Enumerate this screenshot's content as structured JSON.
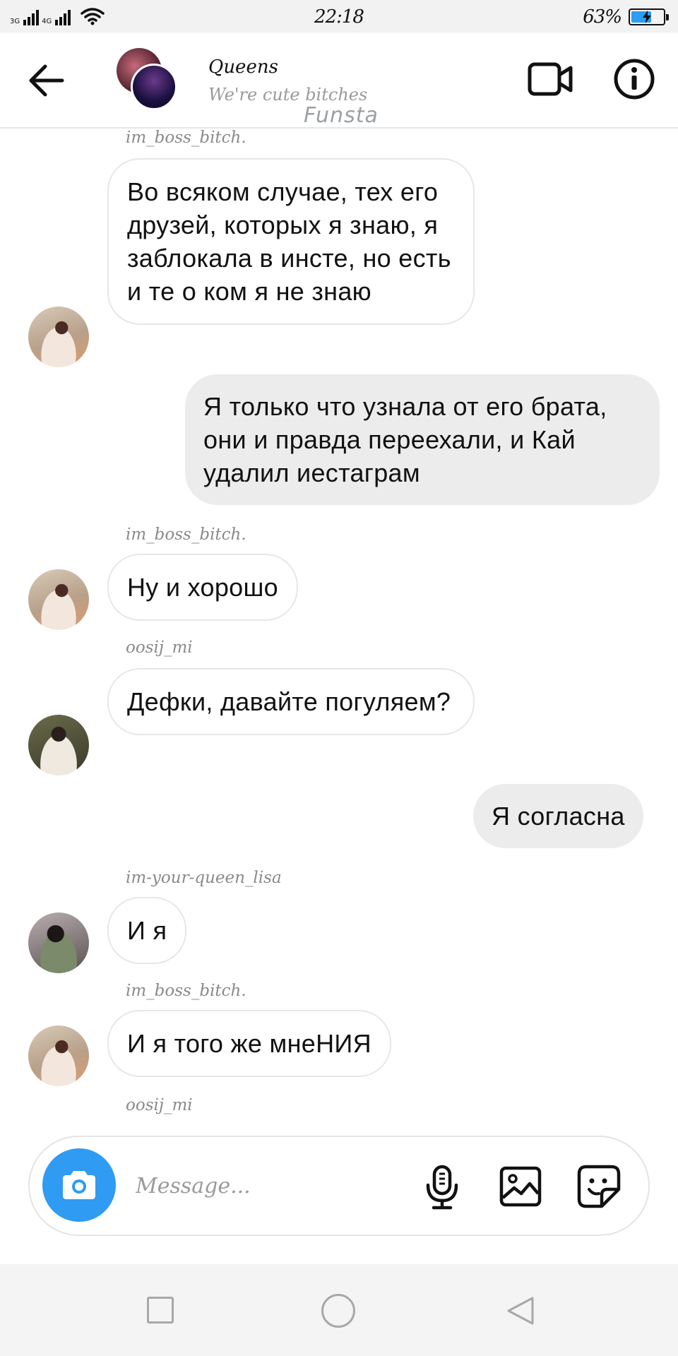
{
  "status_bar": {
    "network_1": "3G",
    "network_2": "4G",
    "time": "22:18",
    "battery_percent": "63%",
    "battery_level": 0.63,
    "battery_color": "#2a9df4"
  },
  "header": {
    "back_icon": "arrow-left-icon",
    "title": "Queens",
    "subtitle": "We're cute bitches",
    "watermark": "Funsta",
    "video_icon": "video-camera-icon",
    "info_icon": "info-icon"
  },
  "messages": [
    {
      "sender": "im_boss_bitch.",
      "text": "Во всяком случае, тех его друзей, которых я знаю, я заблокала в инсте, но есть и те о ком я не знаю",
      "direction": "in"
    },
    {
      "text": "Я только что узнала от его брата, они и правда переехали, и Кай удалил иестаграм",
      "direction": "out"
    },
    {
      "sender": "im_boss_bitch.",
      "text": "Ну и хорошо",
      "direction": "in"
    },
    {
      "sender": "oosij_mi",
      "text": "Дефки, давайте погуляем?",
      "direction": "in"
    },
    {
      "text": "Я согласна",
      "direction": "out"
    },
    {
      "sender": "im-your-queen_lisa",
      "text": "И я",
      "direction": "in"
    },
    {
      "sender": "im_boss_bitch.",
      "text": "И я того же мнеНИЯ",
      "direction": "in"
    },
    {
      "sender": "oosij_mi",
      "direction": "in"
    }
  ],
  "composer": {
    "camera_icon": "camera-icon",
    "placeholder": "Message...",
    "mic_icon": "microphone-icon",
    "gallery_icon": "image-icon",
    "sticker_icon": "sticker-icon",
    "accent_color": "#2f9bf2"
  },
  "nav_bar": {
    "recents_icon": "square-icon",
    "home_icon": "circle-icon",
    "back_icon": "triangle-back-icon"
  }
}
